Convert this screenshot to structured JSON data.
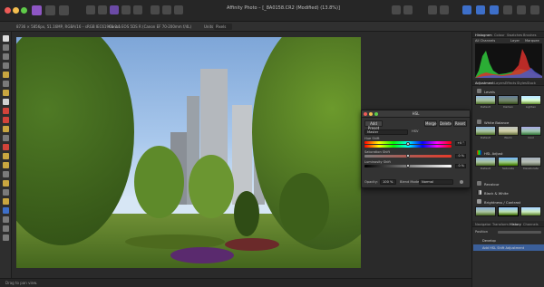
{
  "window": {
    "title": "Affinity Photo – [_8A0158.CR2 (Modified) (13.8%)]"
  },
  "context_bar": {
    "doc_info": "8736 × 5856px, 51.16MP, RGBA/16 – sRGB IEC61966-2.1",
    "camera": "Canon EOS 5DS R (Canon EF 70-200mm f/4L)",
    "units_label": "Units",
    "units_value": "Pixels"
  },
  "hsl_dialog": {
    "title": "HSL",
    "add_preset": "Add Preset",
    "merge": "Merge",
    "delete": "Delete",
    "reset": "Reset",
    "channel": "Master",
    "hsv_label": "HSV",
    "hue_shift_label": "Hue Shift",
    "hue_shift_value": "+0 °",
    "saturation_label": "Saturation Shift",
    "saturation_value": "0 %",
    "luminosity_label": "Luminosity Shift",
    "luminosity_value": "0 %",
    "opacity_label": "Opacity:",
    "opacity_value": "100 %",
    "blend_label": "Blend Mode:",
    "blend_value": "Normal"
  },
  "panel": {
    "top_tabs": [
      "Histogram",
      "Colour",
      "Swatches",
      "Brushes"
    ],
    "histogram": {
      "channel": "All Channels",
      "layer_label": "Layer",
      "marquee_label": "Marquee"
    },
    "mid_tabs": [
      "Adjustment",
      "Layers",
      "Effects",
      "Styles",
      "Stock"
    ],
    "levels_label": "Levels",
    "levels_thumbs": [
      "Default",
      "Darken",
      "Lighten"
    ],
    "white_balance_label": "White Balance",
    "wb_thumbs": [
      "Default",
      "Warm",
      "Cool"
    ],
    "hsl_label": "HSL Adjust",
    "hsl_thumbs": [
      "Default",
      "Saturate",
      "Desaturate"
    ],
    "recolour_label": "Recolour",
    "bw_label": "Black & White",
    "bc_label": "Brightness / Contrast",
    "bottom_tabs": [
      "Navigator",
      "Transform",
      "History",
      "Channels"
    ],
    "layers_label": "Position",
    "layers": [
      "Develop",
      "Add HSL Shift Adjustment"
    ]
  },
  "status": {
    "hint": "Drag to pan view."
  },
  "colors": {
    "accent": "#4a7bd6",
    "panel_bg": "#2d2d2d",
    "toolbar_bg": "#2e2e2e"
  }
}
